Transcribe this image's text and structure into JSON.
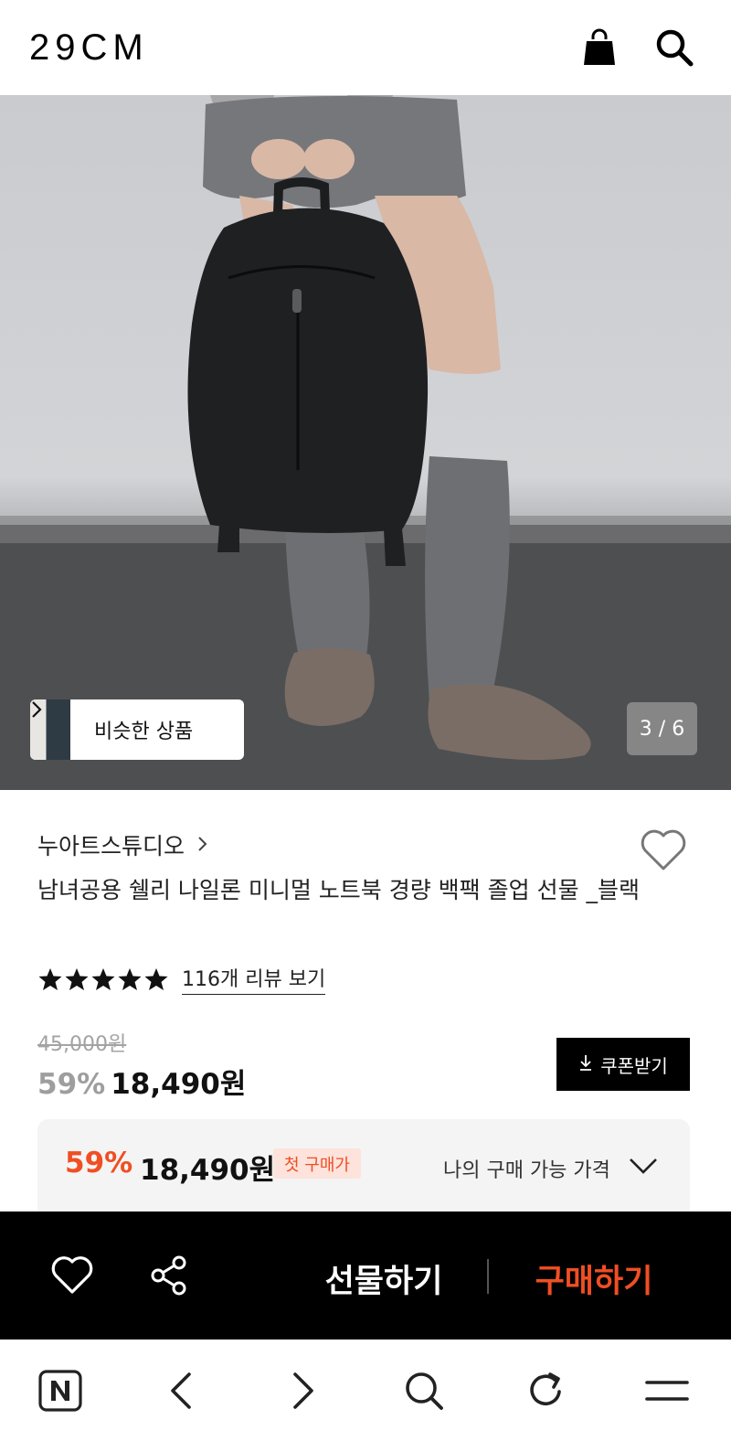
{
  "header": {
    "logo": "29CM",
    "icons": [
      "shopping-bag-icon",
      "search-icon"
    ]
  },
  "gallery": {
    "similar_label": "비슷한 상품",
    "page_indicator": "3 / 6"
  },
  "product": {
    "brand": "누아트스튜디오",
    "title": "남녀공용 쉘리 나일론 미니멀 노트북 경량 백팩 졸업 선물 _블랙",
    "rating_stars": 5,
    "review_link": "116개 리뷰 보기",
    "original_price": "45,000원",
    "discount_rate": "59%",
    "sale_price": "18,490원",
    "coupon_label": "쿠폰받기"
  },
  "my_price": {
    "discount_rate": "59%",
    "price": "18,490원",
    "badge": "첫 구매가",
    "label": "나의 구매 가능 가격"
  },
  "action_bar": {
    "gift_label": "선물하기",
    "buy_label": "구매하기"
  },
  "browser_nav": {
    "icons": [
      "naver-home-icon",
      "back-icon",
      "forward-icon",
      "search-icon",
      "refresh-icon",
      "menu-icon"
    ]
  },
  "colors": {
    "accent": "#f04e23",
    "black": "#000000",
    "muted": "#9e9e9e"
  }
}
